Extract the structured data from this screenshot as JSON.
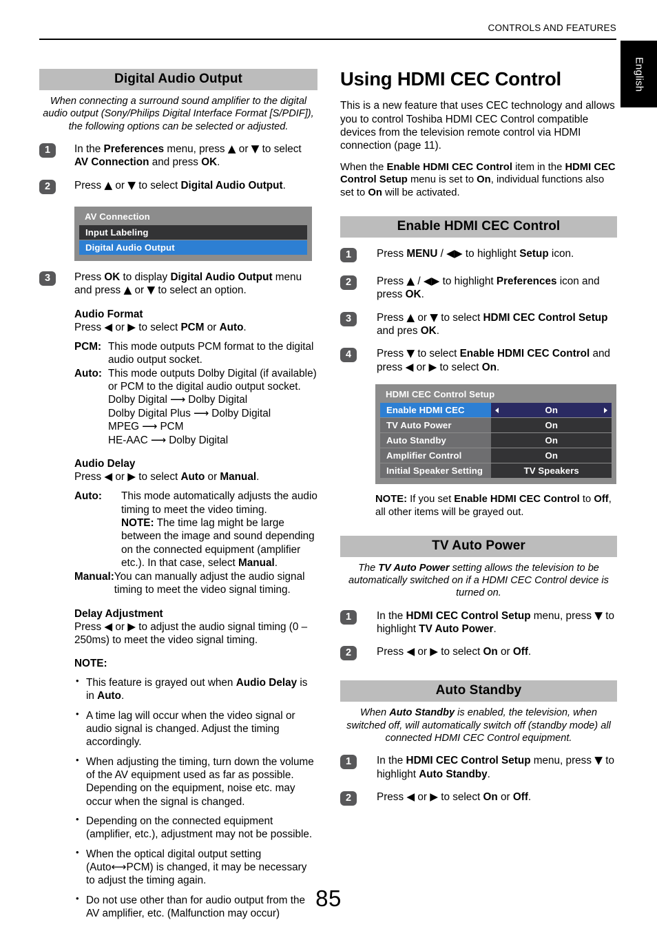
{
  "header": {
    "running_head": "CONTROLS AND FEATURES",
    "language_tab": "English"
  },
  "folio": "85",
  "left_column": {
    "banner": "Digital Audio Output",
    "intro": "When connecting a surround sound amplifier to the digital audio output (Sony/Philips Digital Interface Format [S/PDIF]), the following options can be selected or adjusted.",
    "steps": [
      {
        "num": "1",
        "text_html": "In the <b>Preferences</b> menu, press <span class=\"arr\">▲</span> or <span class=\"arr\">▼</span> to select <b>AV Connection</b> and press <b>OK</b>."
      },
      {
        "num": "2",
        "text_html": "Press <span class=\"arr\">▲</span> or <span class=\"arr\">▼</span> to select <b>Digital Audio Output</b>."
      },
      {
        "num": "3",
        "text_html": "Press <b>OK</b> to display <b>Digital Audio Output</b> menu and press <span class=\"arr\">▲</span> or <span class=\"arr\">▼</span> to select an option."
      }
    ],
    "av_menu": {
      "title": "AV Connection",
      "rows": [
        {
          "label": "Input Labeling",
          "state": "normal"
        },
        {
          "label": "Digital Audio Output",
          "state": "highlighted"
        }
      ]
    },
    "audio_format": {
      "heading": "Audio Format",
      "press_html": "Press <span class=\"arr\">◀</span> or <span class=\"arr\">▶</span> to select <b>PCM</b> or <b>Auto</b>.",
      "defs": [
        {
          "term": "PCM:",
          "body": "This mode outputs PCM format to the digital audio output socket."
        },
        {
          "term": "Auto:",
          "body": "This mode outputs Dolby Digital (if available) or PCM to the digital audio output socket."
        }
      ],
      "mappings": [
        "Dolby Digital ⟶ Dolby Digital",
        "Dolby Digital Plus ⟶ Dolby Digital",
        "MPEG ⟶ PCM",
        "HE-AAC ⟶ Dolby Digital"
      ]
    },
    "audio_delay": {
      "heading": "Audio Delay",
      "press_html": "Press <span class=\"arr\">◀</span> or <span class=\"arr\">▶</span> to select <b>Auto</b> or <b>Manual</b>.",
      "auto_term": "Auto:",
      "auto_body_html": "This mode automatically adjusts the audio timing to meet the video timing.<br><b>NOTE:</b> The time lag might be large between the image and sound depending on the connected equipment (amplifier etc.). In that case, select <b>Manual</b>.",
      "manual_term": "Manual:",
      "manual_body": "You can manually adjust the audio signal timing to meet the video signal timing."
    },
    "delay_adjustment": {
      "heading": "Delay Adjustment",
      "press_html": "Press <span class=\"arr\">◀</span> or <span class=\"arr\">▶</span> to adjust the audio signal timing (0 – 250ms) to meet the video signal timing."
    },
    "note_heading": "NOTE:",
    "notes": [
      "This feature is grayed out when <b>Audio Delay</b> is in <b>Auto</b>.",
      "A time lag will occur when the video signal or audio signal is changed. Adjust the timing accordingly.",
      "When adjusting the timing, turn down the volume of the AV equipment used as far as possible. Depending on the equipment, noise etc. may occur when the signal is changed.",
      "Depending on the connected equipment (amplifier, etc.), adjustment may not be possible.",
      "When the optical digital output setting (Auto<span class=\"arr\">⟷</span>PCM) is changed, it may be necessary to adjust the timing again.",
      "Do not use other than for audio output from the AV amplifier, etc. (Malfunction may occur)"
    ]
  },
  "right_column": {
    "title": "Using HDMI CEC Control",
    "intro1": "This is a new feature that uses CEC technology and allows you to control Toshiba HDMI CEC Control compatible devices from the television remote control via HDMI connection (page 11).",
    "intro2_html": "When the <b>Enable HDMI CEC Control</b> item in the <b>HDMI CEC Control Setup</b> menu is set to <b>On</b>, individual functions also set to <b>On</b> will be activated.",
    "enable_section": {
      "banner": "Enable HDMI CEC Control",
      "steps": [
        {
          "num": "1",
          "text_html": "Press <b>MENU</b> / <span class=\"arr\">◀▶</span> to highlight <b>Setup</b> icon."
        },
        {
          "num": "2",
          "text_html": "Press <span class=\"arr\">▲</span> / <span class=\"arr\">◀▶</span> to highlight <b>Preferences</b> icon and press <b>OK</b>."
        },
        {
          "num": "3",
          "text_html": "Press <span class=\"arr\">▲</span> or <span class=\"arr\">▼</span> to select <b>HDMI CEC Control Setup</b> and pres <b>OK</b>."
        },
        {
          "num": "4",
          "text_html": "Press <span class=\"arr\">▼</span> to select <b>Enable HDMI CEC Control</b> and press <span class=\"arr\">◀</span> or <span class=\"arr\">▶</span> to select <b>On</b>."
        }
      ],
      "cec_menu": {
        "title": "HDMI CEC Control Setup",
        "rows": [
          {
            "label": "Enable HDMI CEC Control",
            "value": "On",
            "state": "highlighted",
            "arrows": true
          },
          {
            "label": "TV Auto Power",
            "value": "On",
            "state": "normal",
            "arrows": false
          },
          {
            "label": "Auto Standby",
            "value": "On",
            "state": "normal",
            "arrows": false
          },
          {
            "label": "Amplifier Control",
            "value": "On",
            "state": "normal",
            "arrows": false
          },
          {
            "label": "Initial Speaker Setting",
            "value": "TV Speakers",
            "state": "normal",
            "arrows": false
          }
        ]
      },
      "note_html": "<b>NOTE:</b> If you set <b>Enable HDMI CEC Control</b> to <b>Off</b>, all other items will be grayed out."
    },
    "tv_auto_power": {
      "banner": "TV Auto Power",
      "intro_html": "The <b>TV Auto Power</b> setting allows the television to be automatically switched on if a HDMI CEC Control device is turned on.",
      "steps": [
        {
          "num": "1",
          "text_html": "In the <b>HDMI CEC Control Setup</b> menu, press <span class=\"arr\">▼</span> to highlight <b>TV Auto Power</b>."
        },
        {
          "num": "2",
          "text_html": "Press <span class=\"arr\">◀</span> or <span class=\"arr\">▶</span> to select <b>On</b> or <b>Off</b>."
        }
      ]
    },
    "auto_standby": {
      "banner": "Auto Standby",
      "intro_html": "When <b>Auto Standby</b> is enabled, the television, when switched off, will automatically switch off (standby mode) all connected HDMI CEC Control equipment.",
      "steps": [
        {
          "num": "1",
          "text_html": "In the <b>HDMI CEC Control Setup</b> menu, press <span class=\"arr\">▼</span> to highlight <b>Auto Standby</b>."
        },
        {
          "num": "2",
          "text_html": "Press <span class=\"arr\">◀</span> or <span class=\"arr\">▶</span> to select <b>On</b> or <b>Off</b>."
        }
      ]
    }
  },
  "colors": {
    "banner_grey": "#bcbcbc",
    "osd_frame_grey": "#8c8c8c",
    "osd_row_dark": "#333335",
    "osd_highlight_blue": "#2d7fd3",
    "osd_value_navy": "#2a2a62",
    "step_badge_grey": "#58585a",
    "tab_black": "#000000"
  }
}
